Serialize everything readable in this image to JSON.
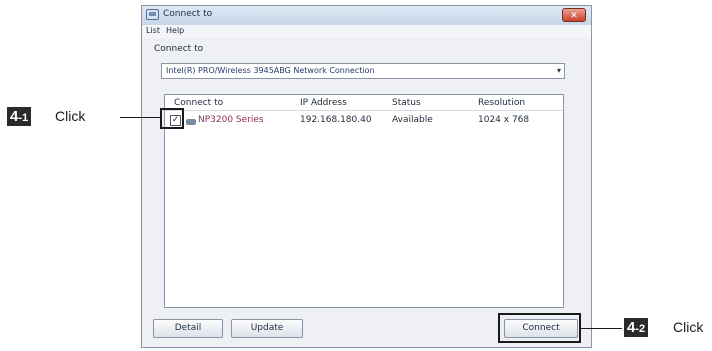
{
  "window": {
    "title": "Connect to",
    "close_glyph": "✕"
  },
  "menu": [
    "List",
    "Help"
  ],
  "connect_section": {
    "label": "Connect to",
    "adapter_value": "Intel(R) PRO/Wireless 3945ABG Network Connection",
    "dropdown_glyph": "▾"
  },
  "list": {
    "columns": [
      "Connect to",
      "IP Address",
      "Status",
      "Resolution"
    ],
    "rows": [
      {
        "checked": true,
        "check_glyph": "✓",
        "name": "NP3200 Series",
        "ip": "192.168.180.40",
        "status": "Available",
        "resolution": "1024 x 768"
      }
    ]
  },
  "buttons": {
    "detail": "Detail",
    "update": "Update",
    "connect": "Connect"
  },
  "annotations": [
    {
      "badge_main": "4",
      "badge_sub": "-1",
      "text": "Click"
    },
    {
      "badge_main": "4",
      "badge_sub": "-2",
      "text": "Click"
    }
  ],
  "colors": {
    "annotation": "#1a1a1a",
    "window_bg": "#eef0f3",
    "device_name": "#8b2f5a"
  }
}
